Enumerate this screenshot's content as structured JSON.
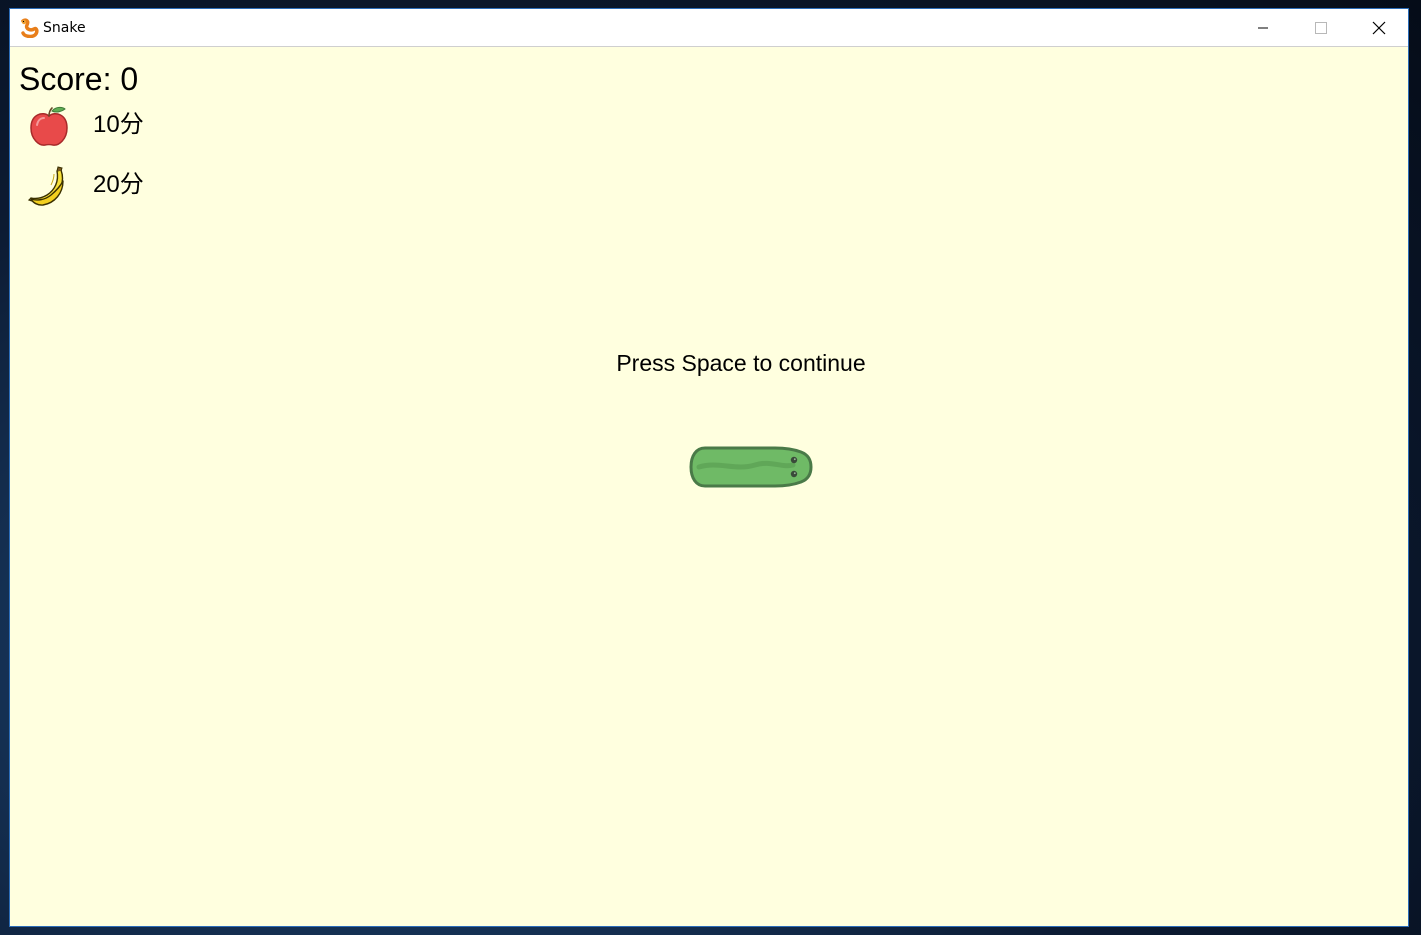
{
  "window": {
    "title": "Snake",
    "app_icon": "snake-app-icon",
    "buttons": [
      "minimize-icon",
      "maximize-icon",
      "close-icon"
    ]
  },
  "game": {
    "score_text": "Score: 0",
    "fruits": [
      {
        "icon": "apple-icon",
        "points_label": "10分"
      },
      {
        "icon": "banana-icon",
        "points_label": "20分"
      }
    ],
    "prompt": "Press Space to continue",
    "snake_direction": "right",
    "snake_length": 2
  },
  "colors": {
    "background": "#ffffdf",
    "snake_fill": "#6fba66",
    "snake_outline": "#4a7a48",
    "apple": "#e84a4a",
    "banana": "#f7e03a"
  }
}
